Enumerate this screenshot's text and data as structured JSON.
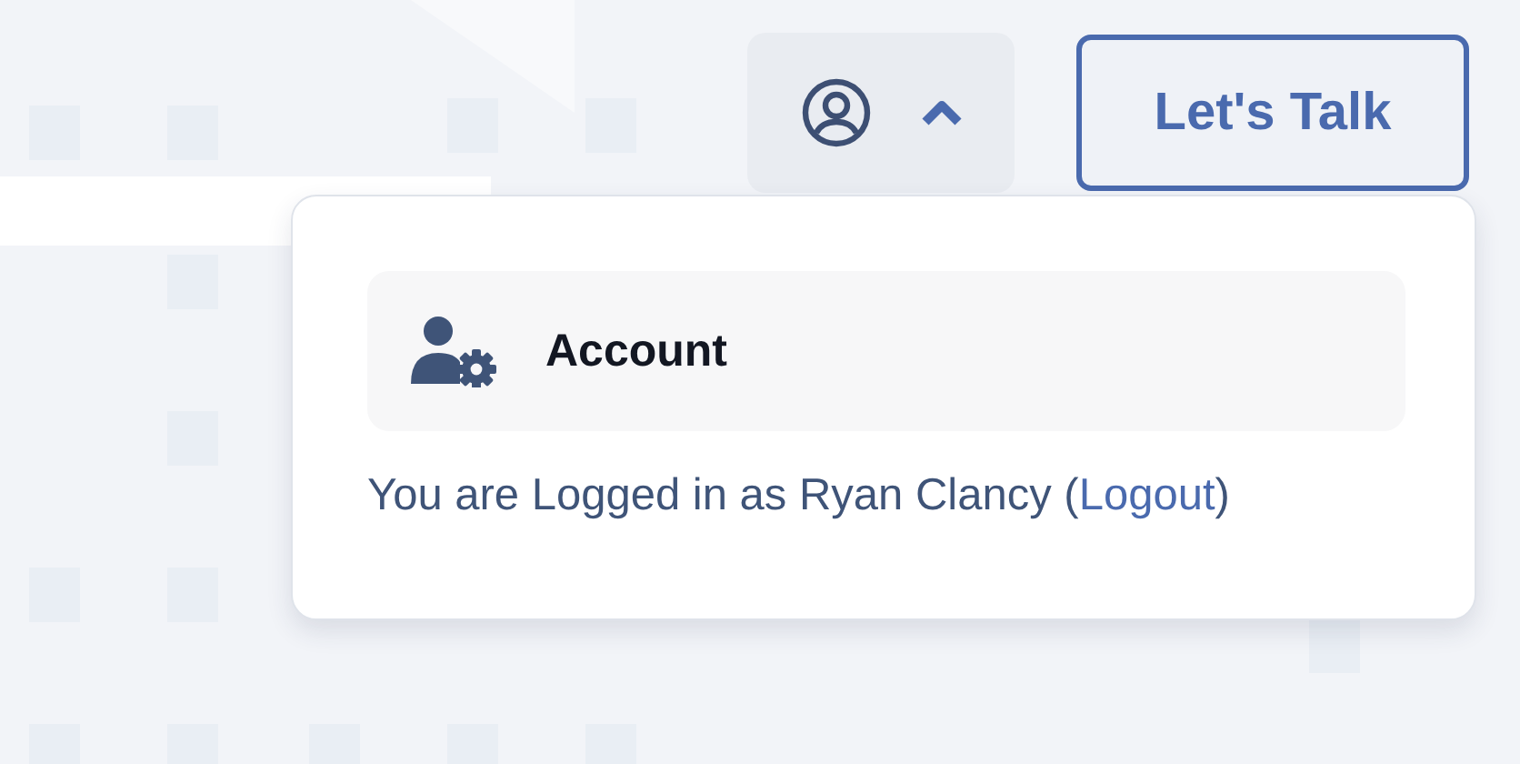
{
  "header": {
    "user_menu": {
      "expanded": true
    },
    "cta_button": "Let's Talk"
  },
  "dropdown": {
    "items": [
      {
        "label": "Account"
      }
    ],
    "status": {
      "text_before": "You are Logged in as Ryan Clancy (",
      "link": "Logout",
      "text_after": ")"
    }
  }
}
